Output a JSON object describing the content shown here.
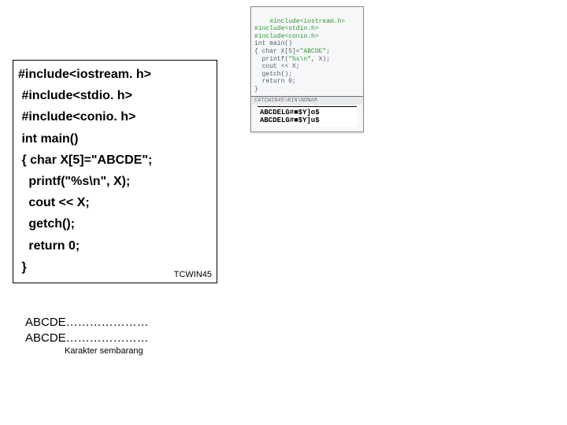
{
  "code": {
    "l1": "#include<iostream. h>",
    "l2": " #include<stdio. h>",
    "l3": " #include<conio. h>",
    "l4": " int main()",
    "l5": " { char X[5]=\"ABCDE\";",
    "l6": "   printf(\"%s\\n\", X);",
    "l7": "   cout << X;",
    "l8": "   getch();",
    "l9": "   return 0;",
    "l10": " }",
    "label": "TCWIN45"
  },
  "output": {
    "l1": "ABCDE…………………",
    "l2": "ABCDE…………………",
    "caption": "Karakter sembarang"
  },
  "thumb": {
    "title": "CATCWIN45\\BIN\\NONAM",
    "code": {
      "l1": "#include<iostream.h>",
      "l2": "#include<stdio.h>",
      "l3": "#include<conio.h>",
      "l4": "int main()",
      "l5a": "{ char X[5]=",
      "l5b": "\"ABCDE\"",
      "l5c": ";",
      "l6a": "  printf(",
      "l6b": "\"%s\\n\"",
      "l6c": ", X);",
      "l7": "  cout << X;",
      "l8": "  getch();",
      "l9": "  return 0;",
      "l10": "}"
    },
    "out": {
      "l1": "ABCDELG#■$Y]o$",
      "l2": "ABCDELG#■$Y]u$"
    }
  }
}
